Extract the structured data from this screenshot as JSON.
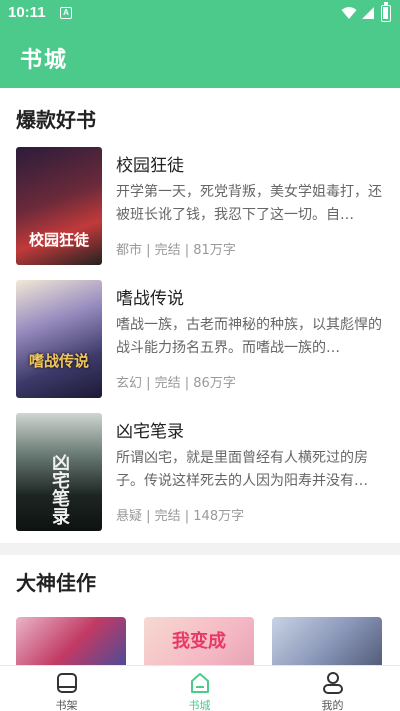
{
  "status": {
    "time": "10:11",
    "notification_badge": "A"
  },
  "appbar": {
    "title": "书城"
  },
  "colors": {
    "accent": "#4cca8c"
  },
  "section1": {
    "title": "爆款好书",
    "books": [
      {
        "name": "校园狂徒",
        "desc": "开学第一天，死党背叛，美女学姐毒打，还被班长讹了钱，我忍下了这一切。自…",
        "meta": "都市 | 完结 | 81万字",
        "cover_text": "校园狂徒"
      },
      {
        "name": "嗜战传说",
        "desc": "嗜战一族，古老而神秘的种族，以其彪悍的战斗能力扬名五界。而嗜战一族的…",
        "meta": "玄幻 | 完结 | 86万字",
        "cover_text": "嗜战传说"
      },
      {
        "name": "凶宅笔录",
        "desc": "所谓凶宅，就是里面曾经有人横死过的房子。传说这样死去的人因为阳寿并没有…",
        "meta": "悬疑 | 完结 | 148万字",
        "cover_text": "凶宅笔录"
      }
    ]
  },
  "section2": {
    "title": "大神佳作",
    "card2_text": "我变成"
  },
  "nav": [
    {
      "label": "书架",
      "icon": "bookshelf-icon"
    },
    {
      "label": "书城",
      "icon": "bookstore-icon"
    },
    {
      "label": "我的",
      "icon": "profile-icon"
    }
  ]
}
